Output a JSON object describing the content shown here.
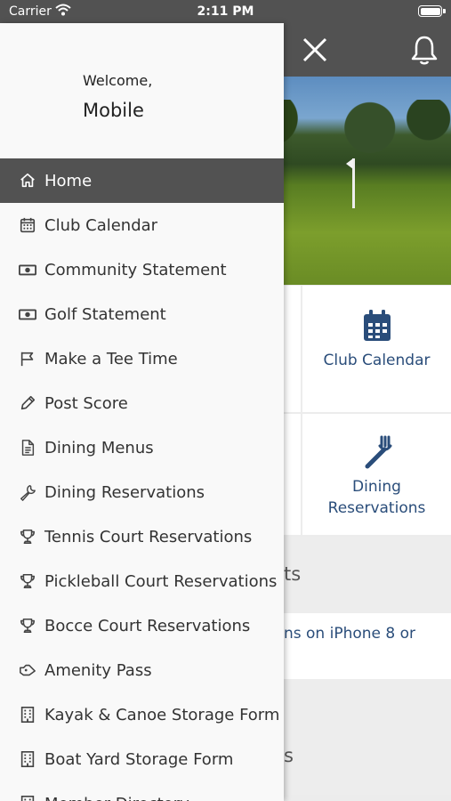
{
  "status_bar": {
    "carrier": "Carrier",
    "time": "2:11 PM"
  },
  "drawer": {
    "greeting": "Welcome,",
    "user_name": "Mobile",
    "menu": [
      {
        "label": "Home",
        "icon": "home-icon",
        "active": true
      },
      {
        "label": "Club Calendar",
        "icon": "calendar-icon"
      },
      {
        "label": "Community Statement",
        "icon": "money-icon"
      },
      {
        "label": "Golf Statement",
        "icon": "money-icon"
      },
      {
        "label": "Make a Tee Time",
        "icon": "flag-icon"
      },
      {
        "label": "Post Score",
        "icon": "pencil-icon"
      },
      {
        "label": "Dining Menus",
        "icon": "document-icon"
      },
      {
        "label": "Dining Reservations",
        "icon": "wrench-icon"
      },
      {
        "label": "Tennis Court Reservations",
        "icon": "trophy-icon"
      },
      {
        "label": "Pickleball Court Reservations",
        "icon": "trophy-icon"
      },
      {
        "label": "Bocce Court Reservations",
        "icon": "trophy-icon"
      },
      {
        "label": "Amenity Pass",
        "icon": "ticket-icon"
      },
      {
        "label": "Kayak & Canoe Storage Form",
        "icon": "building-icon"
      },
      {
        "label": "Boat Yard Storage Form",
        "icon": "building-icon"
      },
      {
        "label": "Member Directory",
        "icon": "building-icon"
      }
    ]
  },
  "background": {
    "tiles": {
      "club_calendar": "Club Calendar",
      "dining_line1": "Dining",
      "dining_line2": "Reservations"
    },
    "section1_fragment": "ts",
    "section2_fragment": "ns on iPhone 8 or",
    "section3_fragment": "s"
  },
  "colors": {
    "header": "#525252",
    "accent": "#2a4d7a",
    "active_menu": "#525252"
  }
}
